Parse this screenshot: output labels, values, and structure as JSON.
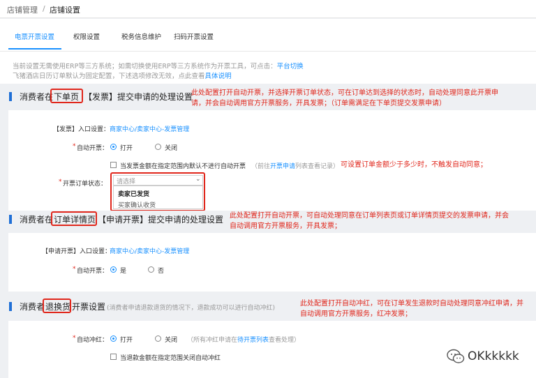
{
  "breadcrumb": {
    "root": "店铺管理",
    "sep": "/",
    "current": "店铺设置"
  },
  "tabs": [
    "电票开票设置",
    "权限设置",
    "税务信息维护",
    "扫码开票设置"
  ],
  "notice": {
    "line1": "当前设置无需使用ERP等三方系统；如需切换使用ERP等三方系统作为开票工具，可点击：",
    "line1_link": "平台切换",
    "line2": "飞猪酒店日历订单默认为固定配置，下述选项修改无效，点此查看",
    "line2_link": "具体说明"
  },
  "section1": {
    "title_pre": "消费者在",
    "title_box": "下单页",
    "title_post": "【发票】提交申请的处理设置",
    "annot_line1": "此处配置打开自动开票，并选择开票订单状态，可在订单达到选择的状态时，自动处理同意此开票申",
    "annot_line2": "请，并会自动调用官方开票服务，开具发票；（订单需满足在下单页提交发票申请）",
    "entry_label": "【发票】入口设置：",
    "entry_link": "商家中心/卖家中心-发票管理",
    "auto_label": "自动开票：",
    "opt_on": "打开",
    "opt_off": "关闭",
    "amount_check": "当发票金额在指定范围内默认不进行自动开票",
    "amount_note_pre": "（前往",
    "amount_note_link": "开票申请",
    "amount_note_post": "列表查看记录）",
    "amount_annot": "可设置订单金额少于多少时，不触发自动同意；",
    "status_label": "开票订单状态：",
    "status_placeholder": "请选择",
    "status_options": [
      "卖家已发货",
      "买家确认收货"
    ]
  },
  "section2": {
    "title_pre": "消费者在",
    "title_box": "订单详情页",
    "title_post": "【申请开票】提交申请的处理设置",
    "annot_line1": "此处配置打开自动开票，可自动处理同意在订单列表页或订单详情页提交的发票申请，并会",
    "annot_line2": "自动调用官方开票服务，开具发票；",
    "entry_label": "【申请开票】入口设置：",
    "entry_link": "商家中心/卖家中心-发票管理",
    "auto_label": "自动开票：",
    "opt_yes": "是",
    "opt_no": "否"
  },
  "section3": {
    "title_pre": "消费者",
    "title_box": "退换货",
    "title_post": "开票设置",
    "title_note": "(消费者申请退款退货的情况下，退款成功可以进行自动冲红)",
    "annot_line1": "此处配置打开自动冲红，可在订单发生退款时自动处理同意冲红申请，并",
    "annot_line2": "自动调用官方开票服务，红冲发票；",
    "auto_label": "自动冲红：",
    "opt_on": "打开",
    "opt_off": "关闭",
    "off_note_pre": "（所有冲红申请在",
    "off_note_link": "待开票列表",
    "off_note_post": "查看处理）",
    "refund_check": "当退款金额在指定范围关闭自动冲红"
  },
  "watermark": "OKkkkkk",
  "colors": {
    "accent": "#1890ff",
    "annotation": "#e0261b",
    "bar": "#1f6fd6"
  }
}
